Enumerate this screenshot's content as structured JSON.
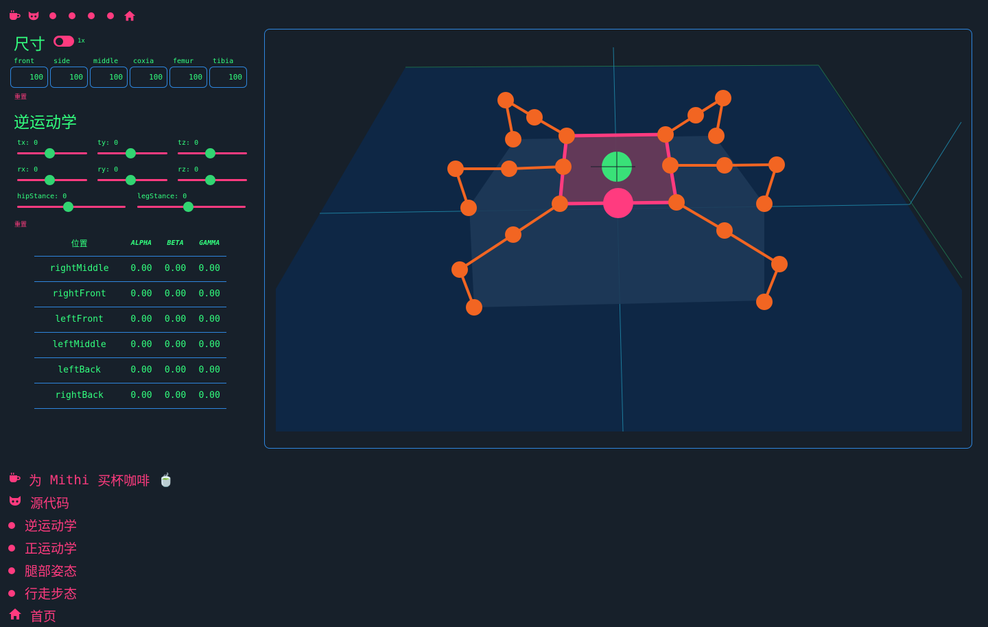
{
  "dimensions": {
    "title": "尺寸",
    "toggle_label": "1x",
    "fields": [
      {
        "label": "front",
        "value": "100"
      },
      {
        "label": "side",
        "value": "100"
      },
      {
        "label": "middle",
        "value": "100"
      },
      {
        "label": "coxia",
        "value": "100"
      },
      {
        "label": "femur",
        "value": "100"
      },
      {
        "label": "tibia",
        "value": "100"
      }
    ],
    "reset_label": "重置"
  },
  "ik": {
    "title": "逆运动学",
    "sliders": [
      {
        "label": "tx: 0",
        "fraction": 0.46
      },
      {
        "label": "ty: 0",
        "fraction": 0.47
      },
      {
        "label": "tz: 0",
        "fraction": 0.47
      },
      {
        "label": "rx: 0",
        "fraction": 0.46
      },
      {
        "label": "ry: 0",
        "fraction": 0.47
      },
      {
        "label": "rz: 0",
        "fraction": 0.47
      },
      {
        "label": "hipStance: 0",
        "fraction": 0.47
      },
      {
        "label": "legStance: 0",
        "fraction": 0.47
      }
    ],
    "reset_label": "重置"
  },
  "table": {
    "headers": [
      "位置",
      "ALPHA",
      "BETA",
      "GAMMA"
    ],
    "rows": [
      [
        "rightMiddle",
        "0.00",
        "0.00",
        "0.00"
      ],
      [
        "rightFront",
        "0.00",
        "0.00",
        "0.00"
      ],
      [
        "leftFront",
        "0.00",
        "0.00",
        "0.00"
      ],
      [
        "leftMiddle",
        "0.00",
        "0.00",
        "0.00"
      ],
      [
        "leftBack",
        "0.00",
        "0.00",
        "0.00"
      ],
      [
        "rightBack",
        "0.00",
        "0.00",
        "0.00"
      ]
    ]
  },
  "bottom_nav": {
    "coffee": {
      "prefix": "为",
      "name": "Mithi",
      "suffix": "买杯咖啡",
      "emoji": "🍵"
    },
    "source": "源代码",
    "items": [
      "逆运动学",
      "正运动学",
      "腿部姿态",
      "行走步态"
    ],
    "home": "首页"
  },
  "icons": {
    "coffee": "coffee-icon",
    "github": "github-icon",
    "home": "home-icon"
  },
  "colors": {
    "background": "#17202a",
    "accent_pink": "#ff3b7f",
    "accent_green": "#32ff7e",
    "border_blue": "#2e86de",
    "leg_orange": "#f26522"
  }
}
